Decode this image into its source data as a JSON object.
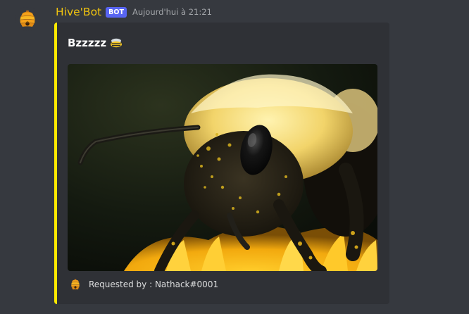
{
  "author": {
    "username": "Hive'Bot",
    "bot_tag": "BOT",
    "timestamp": "Aujourd'hui à 21:21",
    "avatar_icon": "beehive-icon",
    "name_color": "#f1c40f"
  },
  "embed": {
    "accent_color": "#fee900",
    "title": "Bzzzzz",
    "title_icon": "bee-icon",
    "image_subject": "bumblebee-closeup-photo",
    "footer": {
      "icon": "beehive-icon",
      "text": "Requested by : Nathack#0001"
    }
  }
}
